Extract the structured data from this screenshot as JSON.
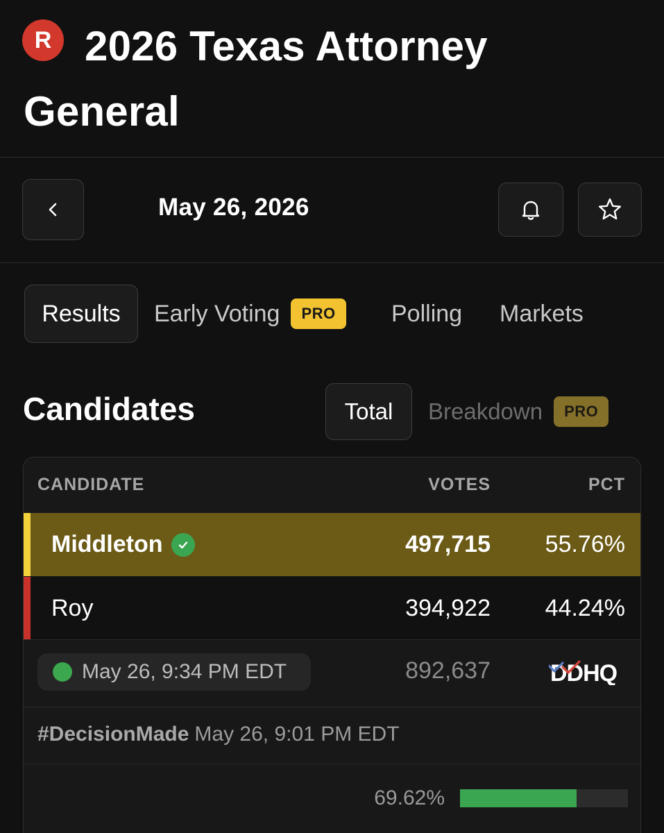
{
  "header": {
    "party_letter": "R",
    "title": "2026 Texas Attorney General"
  },
  "datebar": {
    "date": "May 26, 2026",
    "icons": [
      "chevron-left-icon",
      "bell-icon",
      "star-icon"
    ]
  },
  "tabs": [
    {
      "label": "Results",
      "active": true
    },
    {
      "label": "Early Voting",
      "badge": "PRO"
    },
    {
      "label": "Polling"
    },
    {
      "label": "Markets"
    }
  ],
  "candidates": {
    "heading": "Candidates",
    "view_total": "Total",
    "view_breakdown": "Breakdown",
    "breakdown_badge": "PRO"
  },
  "table": {
    "columns": [
      "CANDIDATE",
      "VOTES",
      "PCT"
    ],
    "rows": [
      {
        "name": "Middleton",
        "votes": "497,715",
        "pct": "55.76%",
        "winner": true,
        "color": "#f2c230"
      },
      {
        "name": "Roy",
        "votes": "394,922",
        "pct": "44.24%",
        "winner": false,
        "color": "#c8322a"
      }
    ],
    "updated": "May 26, 9:34 PM EDT",
    "total_votes": "892,637",
    "source": "DDHQ",
    "decision_tag": "#DecisionMade",
    "decision_time": "May 26, 9:01 PM EDT",
    "reporting_label": "69.62%",
    "reporting_fraction": 0.6962
  },
  "colors": {
    "background": "#111111",
    "winner_row": "#6b5b17",
    "republican": "#d2382c",
    "pro_badge": "#f2c230",
    "live_green": "#3ba74f"
  }
}
